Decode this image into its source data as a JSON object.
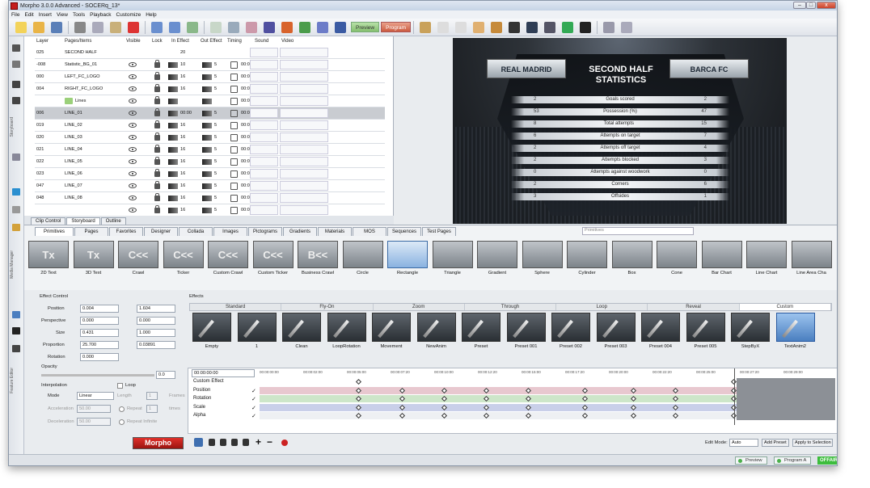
{
  "app": {
    "title": "Morpho 3.0.0 Advanced - SOCERq_13*"
  },
  "menu": [
    "File",
    "Edit",
    "Insert",
    "View",
    "Tools",
    "Playback",
    "Customize",
    "Help"
  ],
  "toolbar": {
    "preview_label": "Preview",
    "program_label": "Program"
  },
  "side_labels": {
    "storyboard": "Storyboard",
    "media": "Media Manager",
    "feature": "Feature Editor"
  },
  "storyboard": {
    "headers": [
      "Layer",
      "Pages/Items",
      "Visible",
      "Lock",
      "In Effect",
      "Out Effect",
      "Timing",
      "Sound",
      "Video"
    ],
    "rows": [
      {
        "layer": "025",
        "name": "SECOND HALF",
        "in": "20",
        "out": "",
        "timing": "",
        "visible": false,
        "lock": false,
        "eff": false,
        "tm": false
      },
      {
        "layer": "-008",
        "name": "Statistic_BG_01",
        "in": "10",
        "out": "5",
        "timing": "00:00",
        "visible": true,
        "lock": true,
        "eff": true,
        "tm": true
      },
      {
        "layer": "000",
        "name": "LEFT_FC_LOGO",
        "in": "16",
        "out": "5",
        "timing": "00:00",
        "visible": true,
        "lock": true,
        "eff": true,
        "tm": true
      },
      {
        "layer": "004",
        "name": "RIGHT_FC_LOGO",
        "in": "16",
        "out": "5",
        "timing": "00:00",
        "visible": true,
        "lock": true,
        "eff": true,
        "tm": true
      },
      {
        "layer": "",
        "name": "Lines",
        "in": "",
        "out": "",
        "timing": "00:00",
        "visible": true,
        "lock": true,
        "eff": true,
        "tm": true
      },
      {
        "layer": "006",
        "name": "LINE_01",
        "in": "00:00",
        "out": "5",
        "timing": "00:03",
        "visible": true,
        "lock": true,
        "eff": true,
        "tm": true
      },
      {
        "layer": "019",
        "name": "LINE_02",
        "in": "16",
        "out": "5",
        "timing": "00:02",
        "visible": true,
        "lock": true,
        "eff": true,
        "tm": true
      },
      {
        "layer": "020",
        "name": "LINE_03",
        "in": "16",
        "out": "5",
        "timing": "00:01",
        "visible": true,
        "lock": true,
        "eff": true,
        "tm": true
      },
      {
        "layer": "021",
        "name": "LINE_04",
        "in": "16",
        "out": "5",
        "timing": "00:01",
        "visible": true,
        "lock": true,
        "eff": true,
        "tm": true
      },
      {
        "layer": "022",
        "name": "LINE_05",
        "in": "16",
        "out": "5",
        "timing": "00:01",
        "visible": true,
        "lock": true,
        "eff": true,
        "tm": true
      },
      {
        "layer": "023",
        "name": "LINE_06",
        "in": "16",
        "out": "5",
        "timing": "00:01",
        "visible": true,
        "lock": true,
        "eff": true,
        "tm": true
      },
      {
        "layer": "047",
        "name": "LINE_07",
        "in": "16",
        "out": "5",
        "timing": "00:01",
        "visible": true,
        "lock": true,
        "eff": true,
        "tm": true
      },
      {
        "layer": "048",
        "name": "LINE_08",
        "in": "16",
        "out": "5",
        "timing": "00:01",
        "visible": true,
        "lock": true,
        "eff": true,
        "tm": true
      },
      {
        "layer": "",
        "name": "",
        "in": "16",
        "out": "5",
        "timing": "00:01",
        "visible": true,
        "lock": true,
        "eff": true,
        "tm": true
      }
    ],
    "tabs": [
      "Clip Control",
      "Storyboard",
      "Outline"
    ]
  },
  "preview": {
    "title_line1": "SECOND HALF",
    "title_line2": "STATISTICS",
    "team_left": "REAL MADRID",
    "team_right": "BARCA FC",
    "stats": [
      {
        "label": "Goals scored",
        "left": "2",
        "right": "2"
      },
      {
        "label": "Possession (%)",
        "left": "53",
        "right": "47"
      },
      {
        "label": "Total attempts",
        "left": "8",
        "right": "15"
      },
      {
        "label": "Attempts on target",
        "left": "6",
        "right": "7"
      },
      {
        "label": "Attempts off target",
        "left": "2",
        "right": "4"
      },
      {
        "label": "Attempts blocked",
        "left": "2",
        "right": "3"
      },
      {
        "label": "Attempts against woodwork",
        "left": "0",
        "right": "0"
      },
      {
        "label": "Corners",
        "left": "2",
        "right": "6"
      },
      {
        "label": "Offsides",
        "left": "3",
        "right": "1"
      }
    ]
  },
  "media": {
    "tabs": [
      "Primitives",
      "Pages",
      "Favorites",
      "Designer",
      "Collada",
      "Images",
      "Pictograms",
      "Gradients",
      "Materials",
      "MOS",
      "Sequences",
      "Test Pages"
    ],
    "search_placeholder": "Primitives",
    "items": [
      "2D Text",
      "3D Text",
      "Crawl",
      "Ticker",
      "Custom Crawl",
      "Custom Ticker",
      "Business Crawl",
      "Circle",
      "Rectangle",
      "Triangle",
      "Gradient",
      "Sphere",
      "Cylinder",
      "Box",
      "Cone",
      "Bar Chart",
      "Line Chart",
      "Line Area Cha"
    ],
    "glyphs": [
      "Tx",
      "Tx",
      "C<<",
      "C<<",
      "C<<",
      "C<<",
      "B<<",
      "",
      "",
      "",
      "",
      "",
      "",
      "",
      "",
      "",
      "",
      ""
    ],
    "selected_index": 8
  },
  "effect_control": {
    "title": "Effect Control",
    "position_label": "Position",
    "position_x": "0.004",
    "position_y": "1.604",
    "perspective_label": "Perspective",
    "perspective_x": "0.000",
    "perspective_y": "0.000",
    "size_label": "Size",
    "size_x": "0.431",
    "size_y": "1.000",
    "proportion_label": "Proportion",
    "proportion_x": "25.700",
    "proportion_y": "0.03891",
    "rotation_label": "Rotation",
    "rotation": "0.000",
    "opacity_label": "Opacity",
    "opacity": "0.0",
    "interpolation_label": "Interpolation",
    "loop_label": "Loop",
    "mode_label": "Mode",
    "mode": "Linear",
    "length_label": "Length",
    "length": "1",
    "frames_label": "Frames",
    "acceleration_label": "Acceleration",
    "acceleration": "50.00",
    "repeat_label": "Repeat",
    "repeat": "1",
    "times_label": "times",
    "deceleration_label": "Deceleration",
    "deceleration": "50.00",
    "repeat_infinite_label": "Repeat Infinite",
    "logo": "Morpho"
  },
  "effects": {
    "title": "Effects",
    "tabs": [
      "Standard",
      "Fly-On",
      "Zoom",
      "Through",
      "Loop",
      "Reveal",
      "Custom"
    ],
    "active_tab": 6,
    "items": [
      "Empty",
      "1",
      "Clean",
      "LoopRotation",
      "Movement",
      "NewAnim",
      "Preset",
      "Preset 001",
      "Preset 002",
      "Preset 003",
      "Preset 004",
      "Preset 005",
      "StepByX",
      "TextAnim2"
    ],
    "selected_index": 13
  },
  "timeline": {
    "time": "00:00:00:00",
    "ruler": [
      "00:00:00:00",
      "00:00:02:00",
      "00:00:05:00",
      "00:00:07:20",
      "00:00:10:00",
      "00:00:12:20",
      "00:00:15:00",
      "00:00:17:20",
      "00:00:20:00",
      "00:00:22:20",
      "00:00:25:00",
      "00:00:27:20",
      "00:00:29:00"
    ],
    "tracks": [
      {
        "name": "Custom Effect",
        "color": "#ffffff",
        "check": ""
      },
      {
        "name": "Position",
        "color": "#e8c8cf",
        "check": "✓"
      },
      {
        "name": "Rotation",
        "color": "#cde6c9",
        "check": "✓"
      },
      {
        "name": "Scale",
        "color": "#c9cfe9",
        "check": "✓"
      },
      {
        "name": "Alpha",
        "color": "#eef0f3",
        "check": "✓"
      }
    ],
    "edit_mode_label": "Edit Mode:",
    "edit_mode": "Auto",
    "add_preset": "Add Preset",
    "apply_selection": "Apply to Selection"
  },
  "status": {
    "preview": "Preview",
    "program": "Program A",
    "offair": "OFFAIR"
  }
}
